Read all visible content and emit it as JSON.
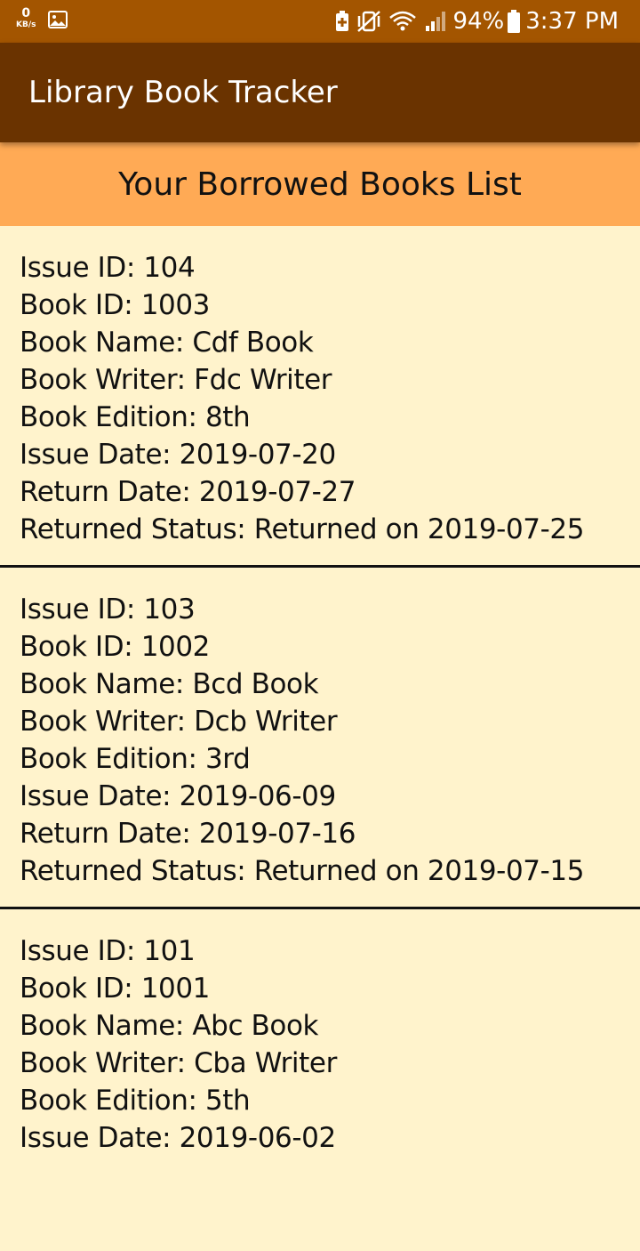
{
  "status_bar": {
    "net_speed_value": "0",
    "net_speed_unit": "KB/s",
    "battery_percent": "94%",
    "time": "3:37 PM",
    "icons": [
      "image-icon",
      "battery-saver-icon",
      "vibrate-icon",
      "wifi-icon",
      "signal-icon",
      "battery-icon"
    ]
  },
  "app_bar": {
    "title": "Library Book Tracker"
  },
  "list_header": {
    "title": "Your Borrowed Books List"
  },
  "books": [
    {
      "issue_id": "Issue ID: 104",
      "book_id": "Book ID: 1003",
      "book_name": "Book Name: Cdf Book",
      "book_writer": "Book Writer: Fdc Writer",
      "book_edition": "Book Edition: 8th",
      "issue_date": "Issue Date: 2019-07-20",
      "return_date": "Return Date: 2019-07-27",
      "returned_status": "Returned Status: Returned on 2019-07-25"
    },
    {
      "issue_id": "Issue ID: 103",
      "book_id": "Book ID: 1002",
      "book_name": "Book Name: Bcd Book",
      "book_writer": "Book Writer: Dcb Writer",
      "book_edition": "Book Edition: 3rd",
      "issue_date": "Issue Date: 2019-06-09",
      "return_date": "Return Date: 2019-07-16",
      "returned_status": "Returned Status: Returned on 2019-07-15"
    },
    {
      "issue_id": "Issue ID: 101",
      "book_id": "Book ID: 1001",
      "book_name": "Book Name: Abc Book",
      "book_writer": "Book Writer: Cba Writer",
      "book_edition": "Book Edition: 5th",
      "issue_date": "Issue Date: 2019-06-02"
    }
  ],
  "colors": {
    "status_bar": "#a35500",
    "app_bar": "#6a3300",
    "list_header": "#ffaa55",
    "background": "#fff3cc",
    "divider": "#111111"
  }
}
